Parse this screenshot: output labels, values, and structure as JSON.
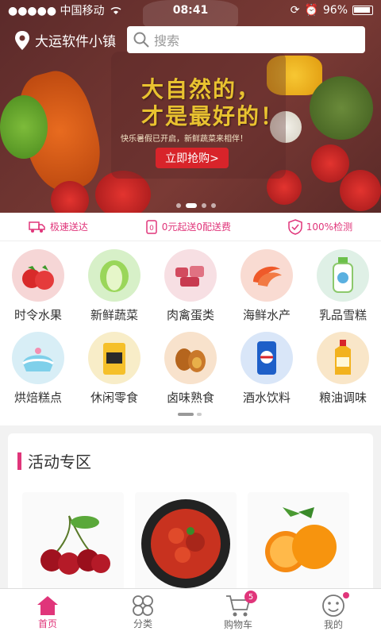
{
  "status": {
    "carrier": "●●●●● 中国移动",
    "time": "08:41",
    "battery": "96%"
  },
  "header": {
    "location": "大运软件小镇",
    "search_placeholder": "搜索"
  },
  "banner": {
    "title_line1": "大自然的，",
    "title_line2": "才是最好的！",
    "subtitle": "快乐暑假已开启，新鲜蔬菜来相伴！",
    "button": "立即抢购>"
  },
  "features": [
    {
      "label": "极速送达",
      "icon": "truck-icon"
    },
    {
      "label": "0元起送0配送费",
      "icon": "receipt-icon"
    },
    {
      "label": "100%检测",
      "icon": "shield-check-icon"
    }
  ],
  "categories": [
    {
      "label": "时令水果",
      "color": "#f6d6d6"
    },
    {
      "label": "新鲜蔬菜",
      "color": "#d7f0c8"
    },
    {
      "label": "肉禽蛋类",
      "color": "#f7dfe3"
    },
    {
      "label": "海鲜水产",
      "color": "#f9dbd2"
    },
    {
      "label": "乳品雪糕",
      "color": "#dff0e6"
    },
    {
      "label": "烘焙糕点",
      "color": "#d8eef6"
    },
    {
      "label": "休闲零食",
      "color": "#f8edc8"
    },
    {
      "label": "卤味熟食",
      "color": "#f8e2cc"
    },
    {
      "label": "酒水饮料",
      "color": "#d9e6f8"
    },
    {
      "label": "粮油调味",
      "color": "#f9e6c8"
    }
  ],
  "activity": {
    "title": "活动专区"
  },
  "tabs": [
    {
      "label": "首页",
      "icon": "home-icon"
    },
    {
      "label": "分类",
      "icon": "category-icon"
    },
    {
      "label": "购物车",
      "icon": "cart-icon",
      "badge": "5"
    },
    {
      "label": "我的",
      "icon": "profile-icon"
    }
  ],
  "colors": {
    "accent": "#e0357a",
    "banner_button": "#d8242a",
    "banner_title": "#e9c230"
  }
}
